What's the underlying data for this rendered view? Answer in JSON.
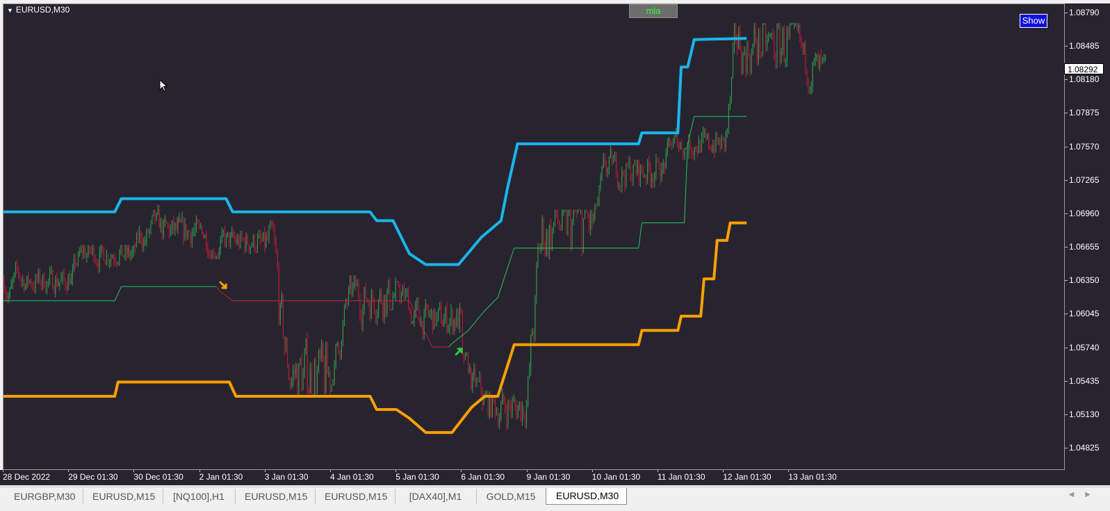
{
  "window": {
    "symbol_title": "EURUSD,M30"
  },
  "buttons": {
    "mla_label": "mla",
    "show_label": "Show"
  },
  "price_axis": {
    "current_price": "1.08292",
    "ticks": [
      {
        "label": "1.08790",
        "value": 1.0879
      },
      {
        "label": "1.08485",
        "value": 1.08485
      },
      {
        "label": "1.08180",
        "value": 1.0818
      },
      {
        "label": "1.07875",
        "value": 1.07875
      },
      {
        "label": "1.07570",
        "value": 1.0757
      },
      {
        "label": "1.07265",
        "value": 1.07265
      },
      {
        "label": "1.06960",
        "value": 1.0696
      },
      {
        "label": "1.06655",
        "value": 1.06655
      },
      {
        "label": "1.06350",
        "value": 1.0635
      },
      {
        "label": "1.06045",
        "value": 1.06045
      },
      {
        "label": "1.05740",
        "value": 1.0574
      },
      {
        "label": "1.05435",
        "value": 1.05435
      },
      {
        "label": "1.05130",
        "value": 1.0513
      },
      {
        "label": "1.04825",
        "value": 1.04825
      }
    ]
  },
  "time_axis": {
    "ticks": [
      "28 Dec 2022",
      "29 Dec 01:30",
      "30 Dec 01:30",
      "2 Jan 01:30",
      "3 Jan 01:30",
      "4 Jan 01:30",
      "5 Jan 01:30",
      "6 Jan 01:30",
      "9 Jan 01:30",
      "10 Jan 01:30",
      "11 Jan 01:30",
      "12 Jan 01:30",
      "13 Jan 01:30"
    ]
  },
  "tabs": [
    {
      "label": "EURGBP,M30",
      "active": false
    },
    {
      "label": "EURUSD,M15",
      "active": false
    },
    {
      "label": "[NQ100],H1",
      "active": false
    },
    {
      "label": "EURUSD,M15",
      "active": false
    },
    {
      "label": "EURUSD,M15",
      "active": false
    },
    {
      "label": "[DAX40],M1",
      "active": false
    },
    {
      "label": "GOLD,M15",
      "active": false
    },
    {
      "label": "EURUSD,M30",
      "active": true
    }
  ],
  "colors": {
    "background": "#28242f",
    "upper_channel": "#1ab6ec",
    "lower_channel": "#ffa000",
    "trail_bull": "#22c55e",
    "trail_bear": "#c0203a",
    "candle_bull": "#2e9e4e",
    "candle_bear": "#c01a3a",
    "arrow_buy": "#2ecc40",
    "arrow_sell": "#ffa000"
  },
  "chart_data": {
    "type": "candlestick",
    "symbol": "EURUSD",
    "timeframe": "M30",
    "ylim": [
      1.0475,
      1.0882
    ],
    "x_range_days": [
      "28 Dec 2022",
      "13 Jan 2023"
    ],
    "candles_approx": [
      {
        "label": "28 Dec 2022",
        "low": 1.0615,
        "high": 1.0668,
        "close": 1.0635
      },
      {
        "label": "29 Dec 01:30",
        "low": 1.0615,
        "high": 1.0668,
        "close": 1.066
      },
      {
        "label": "30 Dec 01:30",
        "low": 1.064,
        "high": 1.0705,
        "close": 1.068
      },
      {
        "label": "2 Jan 01:30",
        "low": 1.0655,
        "high": 1.071,
        "close": 1.067
      },
      {
        "label": "3 Jan 01:30",
        "low": 1.053,
        "high": 1.069,
        "close": 1.055
      },
      {
        "label": "4 Jan 01:30",
        "low": 1.054,
        "high": 1.064,
        "close": 1.062
      },
      {
        "label": "5 Jan 01:30",
        "low": 1.056,
        "high": 1.0635,
        "close": 1.06
      },
      {
        "label": "6 Jan 01:30",
        "low": 1.0483,
        "high": 1.057,
        "close": 1.052
      },
      {
        "label": "9 Jan 01:30",
        "low": 1.052,
        "high": 1.07,
        "close": 1.069
      },
      {
        "label": "10 Jan 01:30",
        "low": 1.069,
        "high": 1.076,
        "close": 1.0735
      },
      {
        "label": "11 Jan 01:30",
        "low": 1.072,
        "high": 1.078,
        "close": 1.076
      },
      {
        "label": "12 Jan 01:30",
        "low": 1.0735,
        "high": 1.087,
        "close": 1.085
      },
      {
        "label": "13 Jan 01:30",
        "low": 1.0785,
        "high": 1.087,
        "close": 1.0829
      }
    ],
    "upper_channel": [
      {
        "t": 0,
        "v": 1.0698
      },
      {
        "t": 1.7,
        "v": 1.0698
      },
      {
        "t": 1.8,
        "v": 1.071
      },
      {
        "t": 3.4,
        "v": 1.071
      },
      {
        "t": 3.5,
        "v": 1.0698
      },
      {
        "t": 5.6,
        "v": 1.0698
      },
      {
        "t": 5.7,
        "v": 1.069
      },
      {
        "t": 5.95,
        "v": 1.069
      },
      {
        "t": 6.2,
        "v": 1.066
      },
      {
        "t": 6.45,
        "v": 1.065
      },
      {
        "t": 6.95,
        "v": 1.065
      },
      {
        "t": 7.3,
        "v": 1.0675
      },
      {
        "t": 7.6,
        "v": 1.069
      },
      {
        "t": 7.7,
        "v": 1.072
      },
      {
        "t": 7.85,
        "v": 1.076
      },
      {
        "t": 9.7,
        "v": 1.076
      },
      {
        "t": 9.75,
        "v": 1.077
      },
      {
        "t": 10.3,
        "v": 1.077
      },
      {
        "t": 10.35,
        "v": 1.083
      },
      {
        "t": 10.45,
        "v": 1.083
      },
      {
        "t": 10.55,
        "v": 1.0855
      },
      {
        "t": 11.35,
        "v": 1.0856
      }
    ],
    "lower_channel": [
      {
        "t": 0,
        "v": 1.053
      },
      {
        "t": 1.7,
        "v": 1.053
      },
      {
        "t": 1.75,
        "v": 1.0543
      },
      {
        "t": 3.45,
        "v": 1.0543
      },
      {
        "t": 3.55,
        "v": 1.053
      },
      {
        "t": 5.6,
        "v": 1.053
      },
      {
        "t": 5.7,
        "v": 1.0518
      },
      {
        "t": 6.0,
        "v": 1.0518
      },
      {
        "t": 6.2,
        "v": 1.051
      },
      {
        "t": 6.45,
        "v": 1.0497
      },
      {
        "t": 6.85,
        "v": 1.0497
      },
      {
        "t": 7.15,
        "v": 1.052
      },
      {
        "t": 7.35,
        "v": 1.053
      },
      {
        "t": 7.55,
        "v": 1.053
      },
      {
        "t": 7.8,
        "v": 1.0577
      },
      {
        "t": 9.7,
        "v": 1.0577
      },
      {
        "t": 9.75,
        "v": 1.059
      },
      {
        "t": 10.3,
        "v": 1.059
      },
      {
        "t": 10.35,
        "v": 1.0603
      },
      {
        "t": 10.65,
        "v": 1.0603
      },
      {
        "t": 10.7,
        "v": 1.0637
      },
      {
        "t": 10.85,
        "v": 1.0637
      },
      {
        "t": 10.9,
        "v": 1.0672
      },
      {
        "t": 11.05,
        "v": 1.0672
      },
      {
        "t": 11.1,
        "v": 1.0688
      },
      {
        "t": 11.35,
        "v": 1.0688
      }
    ],
    "trailing_stop": [
      {
        "t": 0,
        "v": 1.0617,
        "trend": "bull"
      },
      {
        "t": 1.7,
        "v": 1.0617,
        "trend": "bull"
      },
      {
        "t": 1.8,
        "v": 1.063,
        "trend": "bull"
      },
      {
        "t": 3.25,
        "v": 1.063,
        "trend": "bull"
      },
      {
        "t": 3.3,
        "v": 1.0626,
        "trend": "bear"
      },
      {
        "t": 3.5,
        "v": 1.0617,
        "trend": "bear"
      },
      {
        "t": 6.2,
        "v": 1.0617,
        "trend": "bear"
      },
      {
        "t": 6.3,
        "v": 1.0605,
        "trend": "bear"
      },
      {
        "t": 6.55,
        "v": 1.0575,
        "trend": "bear"
      },
      {
        "t": 6.8,
        "v": 1.0575,
        "trend": "bear"
      },
      {
        "t": 6.85,
        "v": 1.0578,
        "trend": "bull"
      },
      {
        "t": 7.1,
        "v": 1.059,
        "trend": "bull"
      },
      {
        "t": 7.35,
        "v": 1.0608,
        "trend": "bull"
      },
      {
        "t": 7.55,
        "v": 1.062,
        "trend": "bull"
      },
      {
        "t": 7.8,
        "v": 1.0665,
        "trend": "bull"
      },
      {
        "t": 9.7,
        "v": 1.0665,
        "trend": "bull"
      },
      {
        "t": 9.75,
        "v": 1.0688,
        "trend": "bull"
      },
      {
        "t": 10.4,
        "v": 1.0688,
        "trend": "bull"
      },
      {
        "t": 10.45,
        "v": 1.076,
        "trend": "bull"
      },
      {
        "t": 10.55,
        "v": 1.0785,
        "trend": "bull"
      },
      {
        "t": 11.35,
        "v": 1.0785,
        "trend": "bull"
      }
    ],
    "signals": [
      {
        "type": "sell",
        "t": 3.25,
        "v": 1.063
      },
      {
        "type": "buy",
        "t": 6.85,
        "v": 1.0572
      }
    ]
  }
}
